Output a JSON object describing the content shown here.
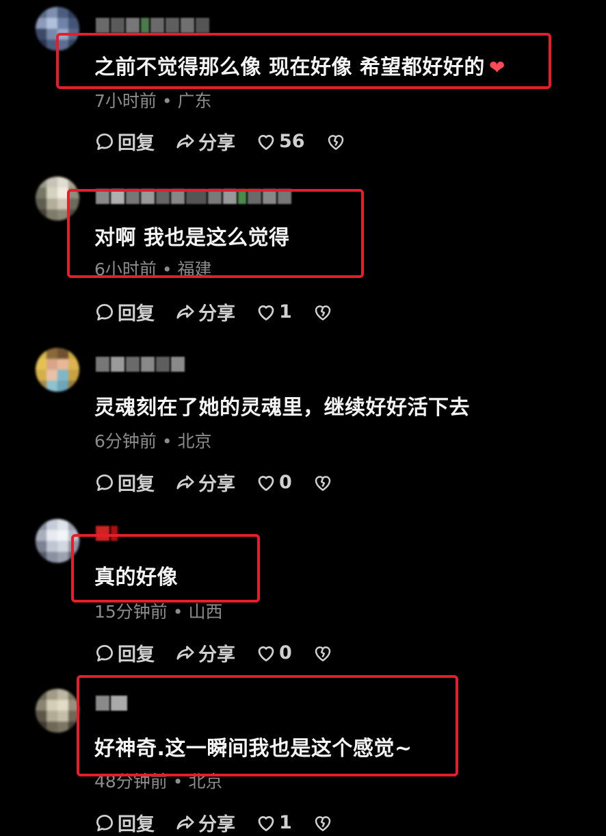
{
  "comments": [
    {
      "text": "之前不觉得那么像 现在好像 希望都好好的",
      "emoji": "❤",
      "meta": "7小时前 • 广东",
      "reply_label": "回复",
      "share_label": "分享",
      "likes": "56"
    },
    {
      "text": "对啊 我也是这么觉得",
      "meta": "6小时前 • 福建",
      "reply_label": "回复",
      "share_label": "分享",
      "likes": "1"
    },
    {
      "text": "灵魂刻在了她的灵魂里，继续好好活下去",
      "meta": "6分钟前 • 北京",
      "reply_label": "回复",
      "share_label": "分享",
      "likes": "0"
    },
    {
      "text": "真的好像",
      "meta": "15分钟前 • 山西",
      "reply_label": "回复",
      "share_label": "分享",
      "likes": "0"
    },
    {
      "text": "好神奇.这一瞬间我也是这个感觉~",
      "meta": "48分钟前 • 北京",
      "reply_label": "回复",
      "share_label": "分享",
      "likes": "1"
    }
  ],
  "icons": {
    "reply": "comment-bubble-icon",
    "share": "share-arrow-icon",
    "like": "heart-outline-icon",
    "dislike": "broken-heart-icon"
  },
  "colors": {
    "highlight_box": "#e41f2b",
    "background": "#000000",
    "text": "#f4f4f4",
    "meta": "#8c8c8c"
  }
}
